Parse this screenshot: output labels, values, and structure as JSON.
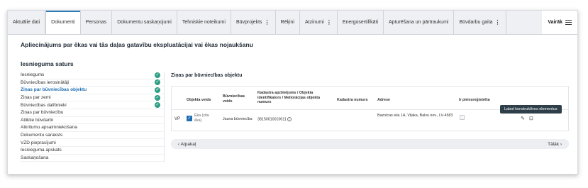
{
  "tabs": [
    {
      "label": "Aktuālie dati",
      "active": false,
      "kebab": ""
    },
    {
      "label": "Dokumenti",
      "active": true,
      "kebab": ""
    },
    {
      "label": "Personas",
      "active": false,
      "kebab": ""
    },
    {
      "label": "Dokumentu saskaņojumi",
      "active": false,
      "kebab": ""
    },
    {
      "label": "Tehniskie noteikumi",
      "active": false,
      "kebab": ""
    },
    {
      "label": "Būvprojekts",
      "active": false,
      "kebab": "⋮"
    },
    {
      "label": "Rēķini",
      "active": false,
      "kebab": ""
    },
    {
      "label": "Atzinumi",
      "active": false,
      "kebab": "⋮"
    },
    {
      "label": "Energosertifikāti",
      "active": false,
      "kebab": ""
    },
    {
      "label": "Apturēšana un pārtraukumi",
      "active": false,
      "kebab": ""
    },
    {
      "label": "Būvdarbu gaita",
      "active": false,
      "kebab": "⋮"
    }
  ],
  "more_label": "Vairāk",
  "page_title": "Apliecinājums par ēkas vai tās daļas gatavību ekspluatācijai vai ēkas nojaukšanu",
  "section_title": "Iesnieguma saturs",
  "sidebar": [
    {
      "label": "Iesniegums",
      "active": false,
      "checked": true
    },
    {
      "label": "Būvniecības ierosinātāji",
      "active": false,
      "checked": true
    },
    {
      "label": "Ziņas par būvniecības objektu",
      "active": true,
      "checked": true
    },
    {
      "label": "Ziņas par zemi",
      "active": false,
      "checked": true
    },
    {
      "label": "Būvniecības dalībnieki",
      "active": false,
      "checked": true
    },
    {
      "label": "Ziņas par būvniecību",
      "active": false,
      "checked": false
    },
    {
      "label": "Atliktie būvdarbi",
      "active": false,
      "checked": false
    },
    {
      "label": "Atkritumu apsaimniekošana",
      "active": false,
      "checked": false
    },
    {
      "label": "Dokumentu saraksts",
      "active": false,
      "checked": false
    },
    {
      "label": "VZD pieprasījumi",
      "active": false,
      "checked": false
    },
    {
      "label": "Iesnieguma apskats",
      "active": false,
      "checked": false
    },
    {
      "label": "Saskaņošana",
      "active": false,
      "checked": false
    }
  ],
  "content_title": "Ziņas par būvniecības objektu",
  "table": {
    "headers": {
      "objekta_veids": "Objekta veids",
      "buvniecibas_veids": "Būvniecības veids",
      "kadastra_apzimejums": "Kadastra apzīmējums / Objekta identifikators / Meliorācijas objekta numurs",
      "kadastra_numurs": "Kadastra numurs",
      "adrese": "Adrese",
      "pirmsregistreta": "Ir pirmsreģistrēta"
    },
    "row": {
      "prefix": "VP",
      "objekta_veids": "Ēka (cita ēka)",
      "buvniecibas_veids": "Jauna būvniecība",
      "kadastra_apzimejums": "38150010010011",
      "kadastra_numurs": "",
      "adrese": "Baznīcas iela 1A, Viļaka, Balvu nov., LV-4583"
    }
  },
  "tooltip": "Labot konstruktīvos elementus",
  "pager": {
    "prev": "Atpakaļ",
    "next": "Tālāk"
  }
}
